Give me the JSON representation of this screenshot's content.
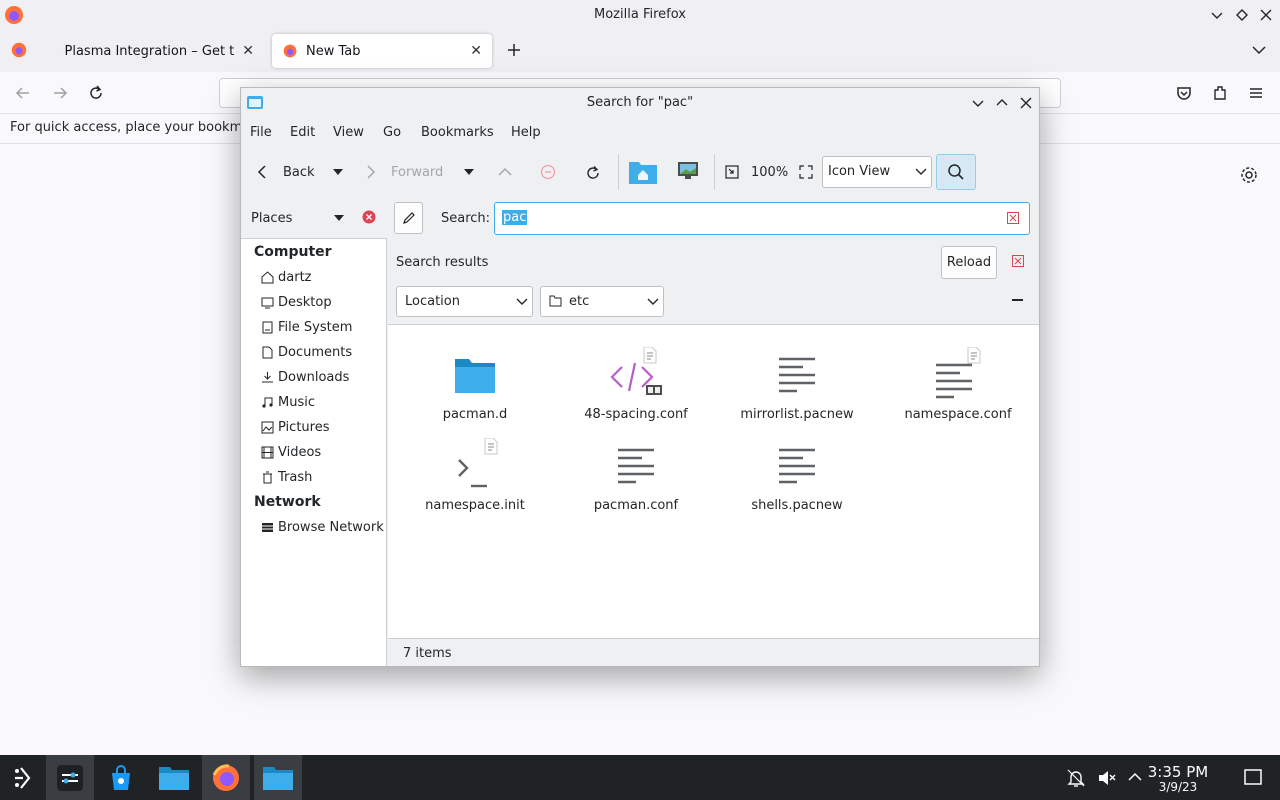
{
  "firefox": {
    "window_title": "Mozilla Firefox",
    "tabs": [
      {
        "label": "Plasma Integration – Get t",
        "active": false
      },
      {
        "label": "New Tab",
        "active": true
      }
    ],
    "bookmarks_hint": "For quick access, place your bookma",
    "content_bg": "#f9f9fb"
  },
  "dialog": {
    "title": "Search for \"pac\"",
    "menu": [
      "File",
      "Edit",
      "View",
      "Go",
      "Bookmarks",
      "Help"
    ],
    "toolbar": {
      "back_label": "Back",
      "forward_label": "Forward",
      "zoom_label": "100%",
      "view_mode": "Icon View"
    },
    "places_label": "Places",
    "search_label": "Search:",
    "search_value": "pac",
    "search_results_label": "Search results",
    "reload_label": "Reload",
    "filter_location": "Location",
    "filter_folder": "etc",
    "places": {
      "computer_heading": "Computer",
      "computer_items": [
        {
          "label": "dartz",
          "icon": "home-icon"
        },
        {
          "label": "Desktop",
          "icon": "desktop-icon"
        },
        {
          "label": "File System",
          "icon": "drive-icon"
        },
        {
          "label": "Documents",
          "icon": "document-icon"
        },
        {
          "label": "Downloads",
          "icon": "download-icon"
        },
        {
          "label": "Music",
          "icon": "music-icon"
        },
        {
          "label": "Pictures",
          "icon": "picture-icon"
        },
        {
          "label": "Videos",
          "icon": "video-icon"
        },
        {
          "label": "Trash",
          "icon": "trash-icon"
        }
      ],
      "network_heading": "Network",
      "network_items": [
        {
          "label": "Browse Network",
          "icon": "network-icon"
        }
      ]
    },
    "files": [
      {
        "name": "pacman.d",
        "icon": "folder-icon"
      },
      {
        "name": "48-spacing.conf",
        "icon": "code-file-icon"
      },
      {
        "name": "mirrorlist.pacnew",
        "icon": "text-file-icon"
      },
      {
        "name": "namespace.conf",
        "icon": "text-file-icon"
      },
      {
        "name": "namespace.init",
        "icon": "script-file-icon"
      },
      {
        "name": "pacman.conf",
        "icon": "text-file-icon"
      },
      {
        "name": "shells.pacnew",
        "icon": "text-file-icon"
      }
    ],
    "status": "7 items",
    "accent": "#3daee9"
  },
  "taskbar": {
    "time": "3:35 PM",
    "date": "3/9/23"
  }
}
